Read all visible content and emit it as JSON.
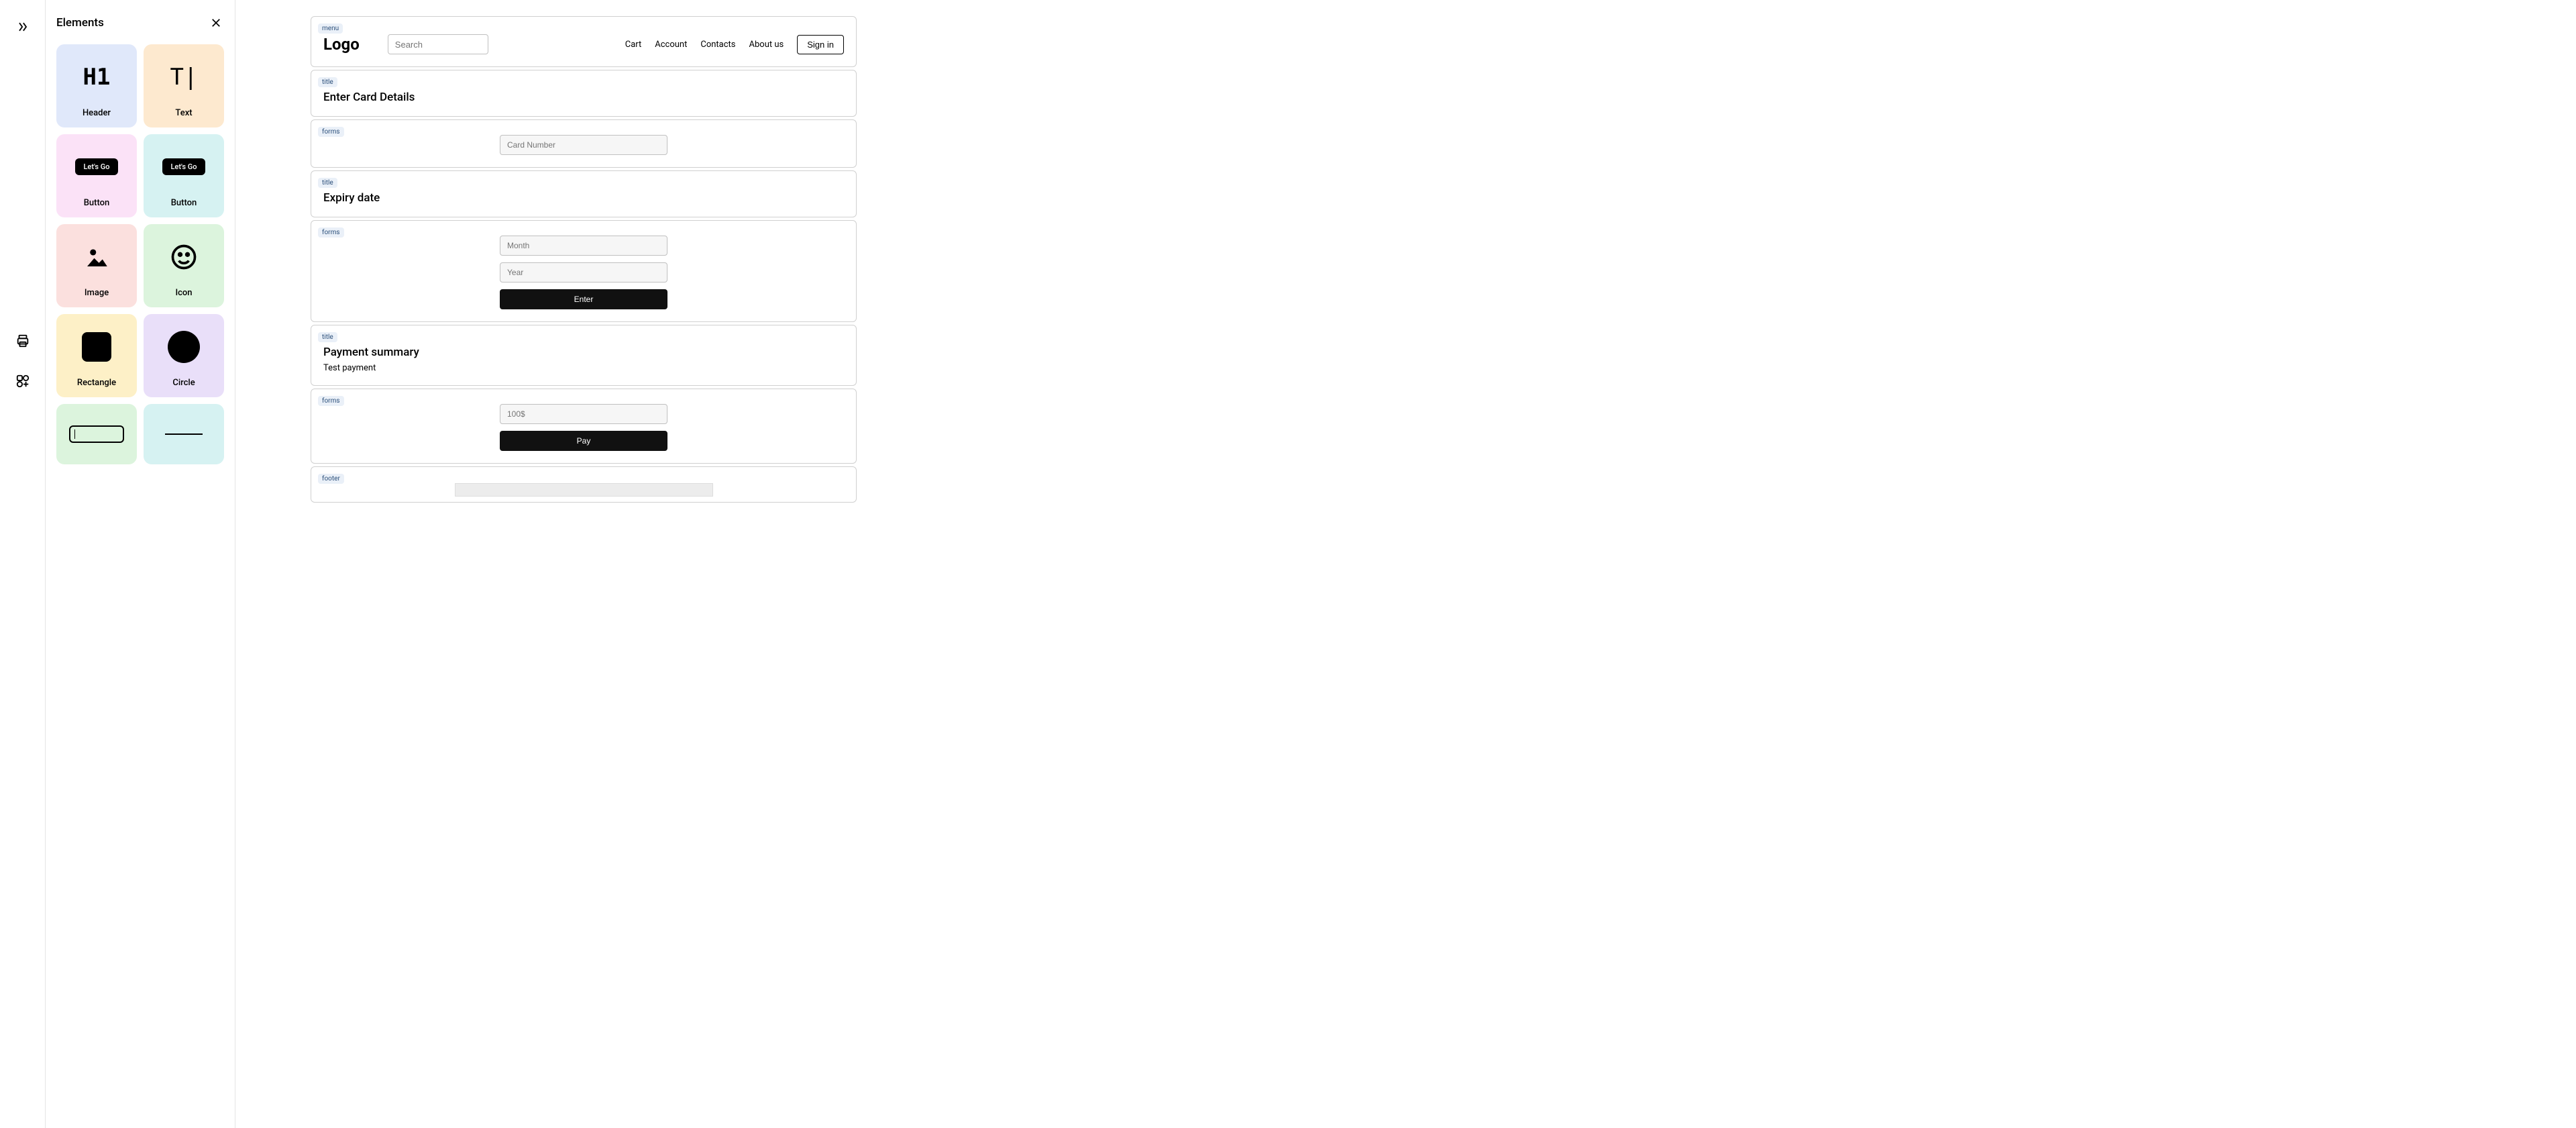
{
  "panel": {
    "title": "Elements",
    "items": [
      {
        "label": "Header",
        "glyph": "H1"
      },
      {
        "label": "Text",
        "glyph": "T|"
      },
      {
        "label": "Button",
        "glyph": "Let's Go"
      },
      {
        "label": "Button",
        "glyph": "Let's Go"
      },
      {
        "label": "Image",
        "glyph": ""
      },
      {
        "label": "Icon",
        "glyph": ""
      },
      {
        "label": "Rectangle",
        "glyph": ""
      },
      {
        "label": "Circle",
        "glyph": ""
      },
      {
        "label": "",
        "glyph": ""
      },
      {
        "label": "",
        "glyph": ""
      }
    ]
  },
  "canvas": {
    "tags": {
      "menu": "menu",
      "title": "title",
      "forms": "forms",
      "footer": "footer"
    },
    "menu": {
      "logo": "Logo",
      "search_placeholder": "Search",
      "links": [
        "Cart",
        "Account",
        "Contacts",
        "About us"
      ],
      "signin": "Sign in"
    },
    "title1": "Enter Card Details",
    "forms1": {
      "card_number_placeholder": "Card Number"
    },
    "title2": "Expiry date",
    "forms2": {
      "month_placeholder": "Month",
      "year_placeholder": "Year",
      "enter_label": "Enter"
    },
    "title3": {
      "heading": "Payment summary",
      "sub": "Test payment"
    },
    "forms3": {
      "amount_placeholder": "100$",
      "pay_label": "Pay"
    }
  }
}
